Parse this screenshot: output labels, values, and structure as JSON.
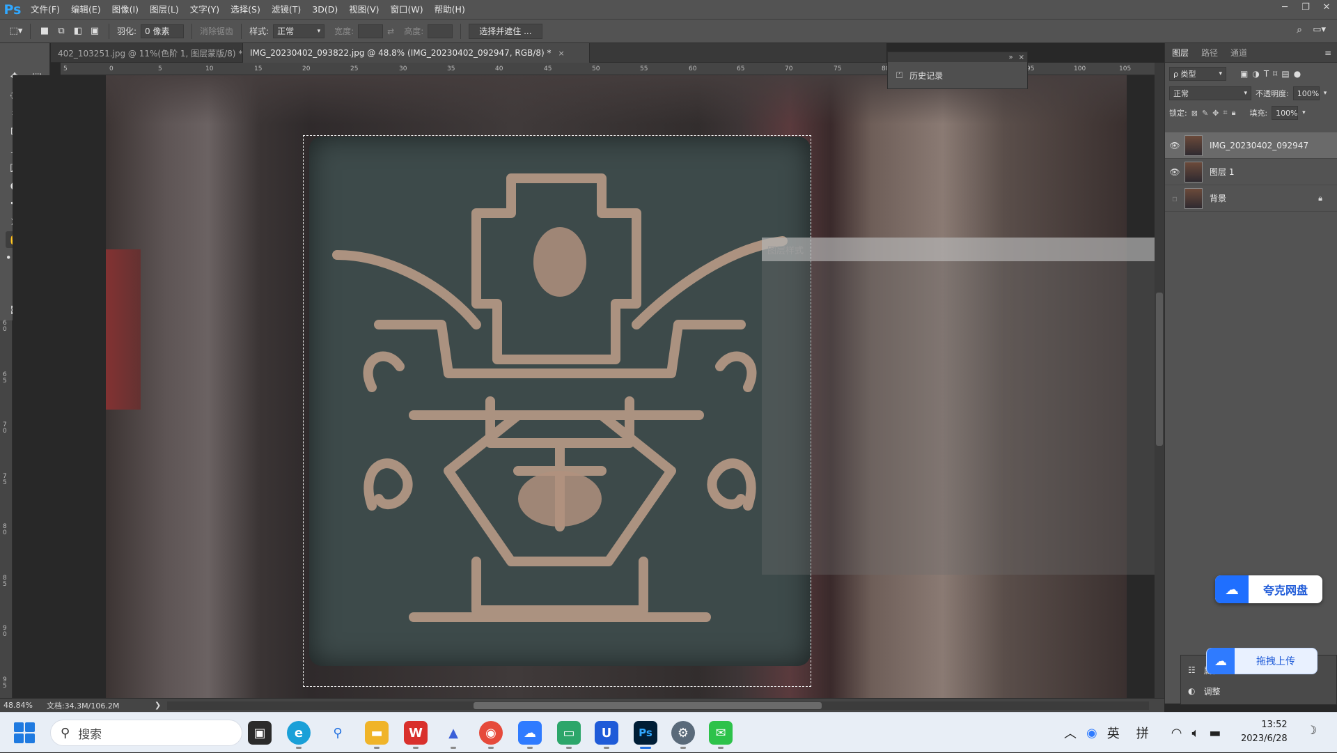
{
  "app": {
    "logo": "Ps"
  },
  "menu": [
    "文件(F)",
    "编辑(E)",
    "图像(I)",
    "图层(L)",
    "文字(Y)",
    "选择(S)",
    "滤镜(T)",
    "3D(D)",
    "视图(V)",
    "窗口(W)",
    "帮助(H)"
  ],
  "options": {
    "feather_label": "羽化:",
    "feather_value": "0 像素",
    "antialias": "消除锯齿",
    "style_label": "样式:",
    "style_value": "正常",
    "width_label": "宽度:",
    "height_label": "高度:",
    "select_mask_button": "选择并遮住 ..."
  },
  "tabs": [
    {
      "label": "402_103251.jpg @ 11%(色阶 1, 图层蒙版/8) *",
      "close": "×"
    },
    {
      "label": "IMG_20230402_093822.jpg @ 48.8% (IMG_20230402_092947, RGB/8) *",
      "close": "×"
    }
  ],
  "ruler_h": [
    "5",
    "0",
    "5",
    "10",
    "15",
    "20",
    "25",
    "30",
    "35",
    "40",
    "45",
    "50",
    "55",
    "60",
    "65",
    "70",
    "75",
    "80",
    "85",
    "90",
    "95",
    "100",
    "105"
  ],
  "ruler_v": [
    "6\n0",
    "6\n5",
    "7\n0",
    "7\n5",
    "8\n0",
    "8\n5",
    "9\n0",
    "9\n5"
  ],
  "history_panel": {
    "title": "历史记录",
    "collapse": "»",
    "close": "×"
  },
  "layer_style_dialog": {
    "title": "图层样式",
    "close": "×"
  },
  "layers_panel": {
    "tabs": [
      "图层",
      "路径",
      "通道"
    ],
    "filter": "ρ 类型",
    "blend_mode": "正常",
    "opacity_label": "不透明度:",
    "opacity_value": "100%",
    "lock_label": "锁定:",
    "fill_label": "填充:",
    "fill_value": "100%",
    "layers": [
      {
        "name": "IMG_20230402_092947",
        "visible": true,
        "selected": true
      },
      {
        "name": "图层 1",
        "visible": true,
        "selected": false
      },
      {
        "name": "背景",
        "visible": false,
        "selected": false,
        "locked": true
      }
    ]
  },
  "mini_panel": {
    "properties": "属性",
    "adjustments": "调整"
  },
  "quark": {
    "label": "夸克网盘",
    "upload_label": "拖拽上传"
  },
  "status": {
    "zoom": "48.84%",
    "doc": "文档:34.3M/106.2M",
    "arrow": "❯"
  },
  "taskbar": {
    "search_placeholder": "搜索",
    "tray": {
      "lang1": "英",
      "lang2": "拼"
    },
    "time": "13:52",
    "date": "2023/6/28"
  },
  "colors": {
    "ps_blue": "#31a8ff",
    "panel_bg": "#535353",
    "taskbar_bg": "#e8eef6",
    "quark_blue": "#1f6fff"
  }
}
